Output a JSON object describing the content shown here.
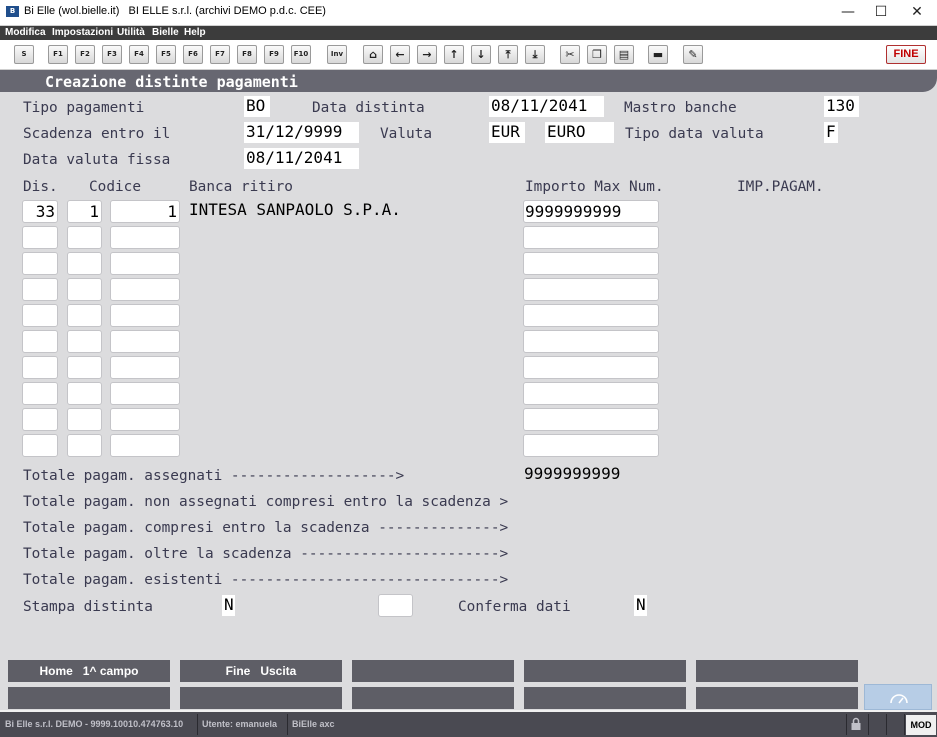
{
  "window": {
    "title": "Bi Elle (wol.bielle.it)   BI ELLE s.r.l. (archivi DEMO p.d.c. CEE)",
    "icon": "app-logo-icon",
    "minimize": "—",
    "maximize": "☐",
    "close": "✕"
  },
  "menu": [
    "Modifica",
    "Impostazioni",
    "Utilità",
    "Bielle",
    "Help"
  ],
  "toolbar": {
    "keys": [
      "S",
      "F1",
      "F2",
      "F3",
      "F4",
      "F5",
      "F6",
      "F7",
      "F8",
      "F9",
      "F10",
      "Inv"
    ],
    "icons": [
      {
        "name": "home-icon",
        "glyph": "⌂"
      },
      {
        "name": "arrow-left-icon",
        "glyph": "←"
      },
      {
        "name": "arrow-right-icon",
        "glyph": "→"
      },
      {
        "name": "arrow-up-icon",
        "glyph": "↑"
      },
      {
        "name": "arrow-down-icon",
        "glyph": "↓"
      },
      {
        "name": "page-top-icon",
        "glyph": "⤒"
      },
      {
        "name": "page-bottom-icon",
        "glyph": "⤓"
      },
      {
        "name": "cut-icon",
        "glyph": "✂"
      },
      {
        "name": "copy-icon",
        "glyph": "❐"
      },
      {
        "name": "paste-icon",
        "glyph": "▤"
      },
      {
        "name": "comment-icon",
        "glyph": "▬"
      },
      {
        "name": "pin-icon",
        "glyph": "✎"
      }
    ],
    "fine": "FINE"
  },
  "screen": {
    "header": "Creazione distinte pagamenti",
    "labels": {
      "tipo_pagamenti": "Tipo pagamenti",
      "data_distinta": "Data distinta",
      "mastro_banche": "Mastro banche",
      "scadenza_entro": "Scadenza entro il",
      "valuta": "Valuta",
      "tipo_data_valuta": "Tipo data valuta",
      "data_valuta_fissa": "Data valuta fissa"
    },
    "values": {
      "tipo_pagamenti": "BO",
      "data_distinta": "08/11/2041",
      "mastro_banche": "130",
      "scadenza_entro": "31/12/9999",
      "valuta_code": "EUR",
      "valuta_name": "EURO",
      "tipo_data_valuta": "F",
      "data_valuta_fissa": "08/11/2041"
    },
    "columns": {
      "dis": "Dis.",
      "codice": "Codice",
      "banca": "Banca ritiro",
      "importo": "Importo Max Num.",
      "imp_pagam": "IMP.PAGAM."
    },
    "rows": [
      {
        "dis": "33",
        "cod1": "1",
        "cod2": "1",
        "banca": "INTESA SANPAOLO S.P.A.",
        "importo": "9999999999"
      },
      {
        "dis": "",
        "cod1": "",
        "cod2": "",
        "banca": "",
        "importo": ""
      },
      {
        "dis": "",
        "cod1": "",
        "cod2": "",
        "banca": "",
        "importo": ""
      },
      {
        "dis": "",
        "cod1": "",
        "cod2": "",
        "banca": "",
        "importo": ""
      },
      {
        "dis": "",
        "cod1": "",
        "cod2": "",
        "banca": "",
        "importo": ""
      },
      {
        "dis": "",
        "cod1": "",
        "cod2": "",
        "banca": "",
        "importo": ""
      },
      {
        "dis": "",
        "cod1": "",
        "cod2": "",
        "banca": "",
        "importo": ""
      },
      {
        "dis": "",
        "cod1": "",
        "cod2": "",
        "banca": "",
        "importo": ""
      },
      {
        "dis": "",
        "cod1": "",
        "cod2": "",
        "banca": "",
        "importo": ""
      },
      {
        "dis": "",
        "cod1": "",
        "cod2": "",
        "banca": "",
        "importo": ""
      }
    ],
    "totals": {
      "assegnati_label": "Totale pagam. assegnati ------------------->",
      "assegnati_value": "9999999999",
      "non_assegnati_label": "Totale pagam. non assegnati compresi entro la scadenza >",
      "compresi_label": "Totale pagam. compresi entro la scadenza -------------->",
      "oltre_label": "Totale pagam. oltre la scadenza ----------------------->",
      "esistenti_label": "Totale pagam. esistenti ------------------------------->"
    },
    "footer": {
      "stampa_label": "Stampa distinta",
      "stampa_value": "N",
      "mid_value": "",
      "conferma_label": "Conferma dati",
      "conferma_value": "N"
    }
  },
  "fkeys": {
    "row1": [
      "Home   1^ campo",
      "Fine   Uscita",
      "",
      "",
      ""
    ],
    "row2": [
      "",
      "",
      "",
      "",
      ""
    ],
    "gauge_icon": "speedometer-icon"
  },
  "status": {
    "company": "Bi Elle s.r.l. DEMO - 9999.10010.474763.10",
    "user": "Utente: emanuela",
    "app": "BiElle axc",
    "lock_icon": "lock-icon",
    "mode": "MOD"
  }
}
